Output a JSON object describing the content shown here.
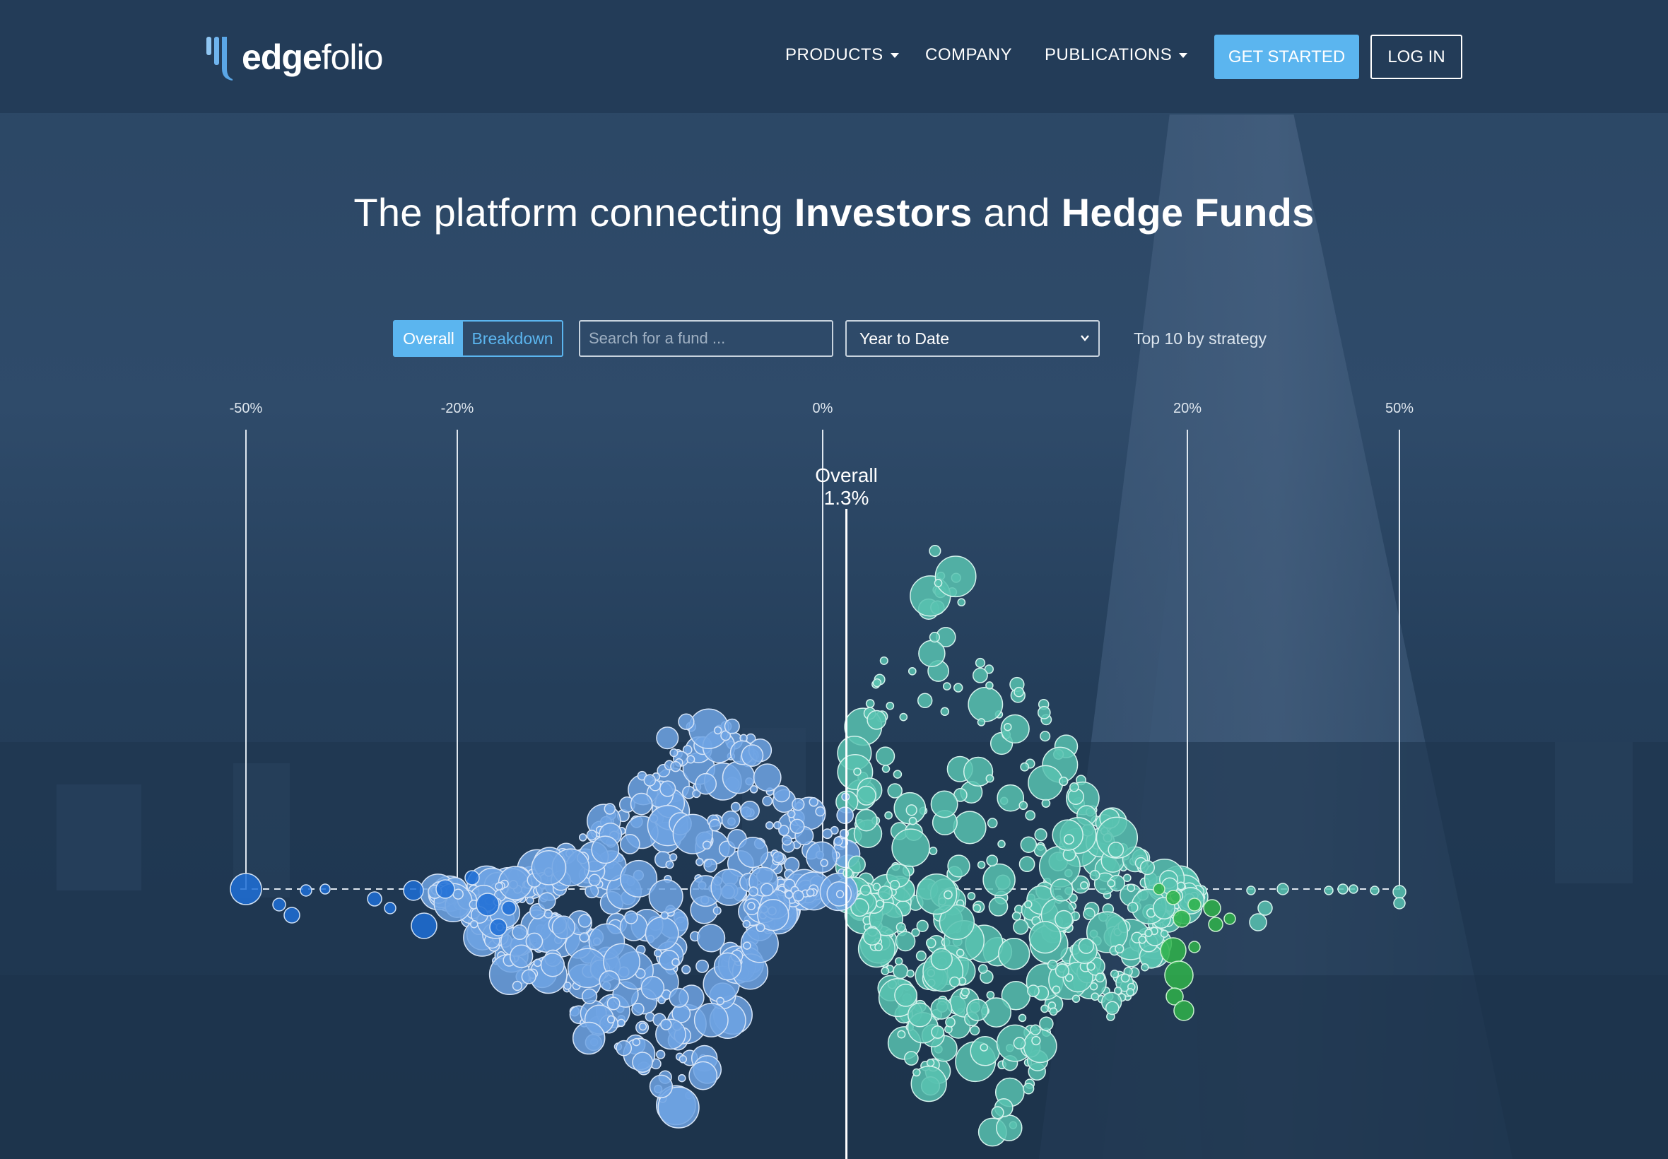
{
  "nav": {
    "logo_bold": "edge",
    "logo_light": "folio",
    "products": "PRODUCTS",
    "company": "COMPANY",
    "publications": "PUBLICATIONS",
    "get_started": "GET STARTED",
    "log_in": "LOG IN"
  },
  "hero": {
    "part1": "The platform connecting ",
    "investors": "Investors",
    "part2": " and ",
    "hedge_funds": "Hedge Funds"
  },
  "controls": {
    "toggle_overall": "Overall",
    "toggle_breakdown": "Breakdown",
    "selected_toggle": "Overall",
    "search_placeholder": "Search for a fund ...",
    "period_value": "Year to Date",
    "top10_label": "Top 10 by strategy"
  },
  "colors": {
    "accent": "#5bb5ef",
    "negative": "#6fa3e3",
    "negative_dark": "#1f6fd6",
    "positive": "#58c2b0",
    "positive_top": "#2fb34a"
  },
  "chart_data": {
    "type": "scatter",
    "title": "",
    "x_ticks": [
      "-50%",
      "-20%",
      "0%",
      "20%",
      "50%"
    ],
    "x_tick_values": [
      -50,
      -20,
      0,
      20,
      50
    ],
    "overall_label": "Overall",
    "overall_value_label": "1.3%",
    "overall_value": 1.3,
    "xlabel": "",
    "ylabel": "",
    "series": [
      {
        "color": "negative",
        "description_range": [
          -20,
          0
        ]
      },
      {
        "color": "positive",
        "description_range": [
          0,
          20
        ]
      }
    ]
  }
}
